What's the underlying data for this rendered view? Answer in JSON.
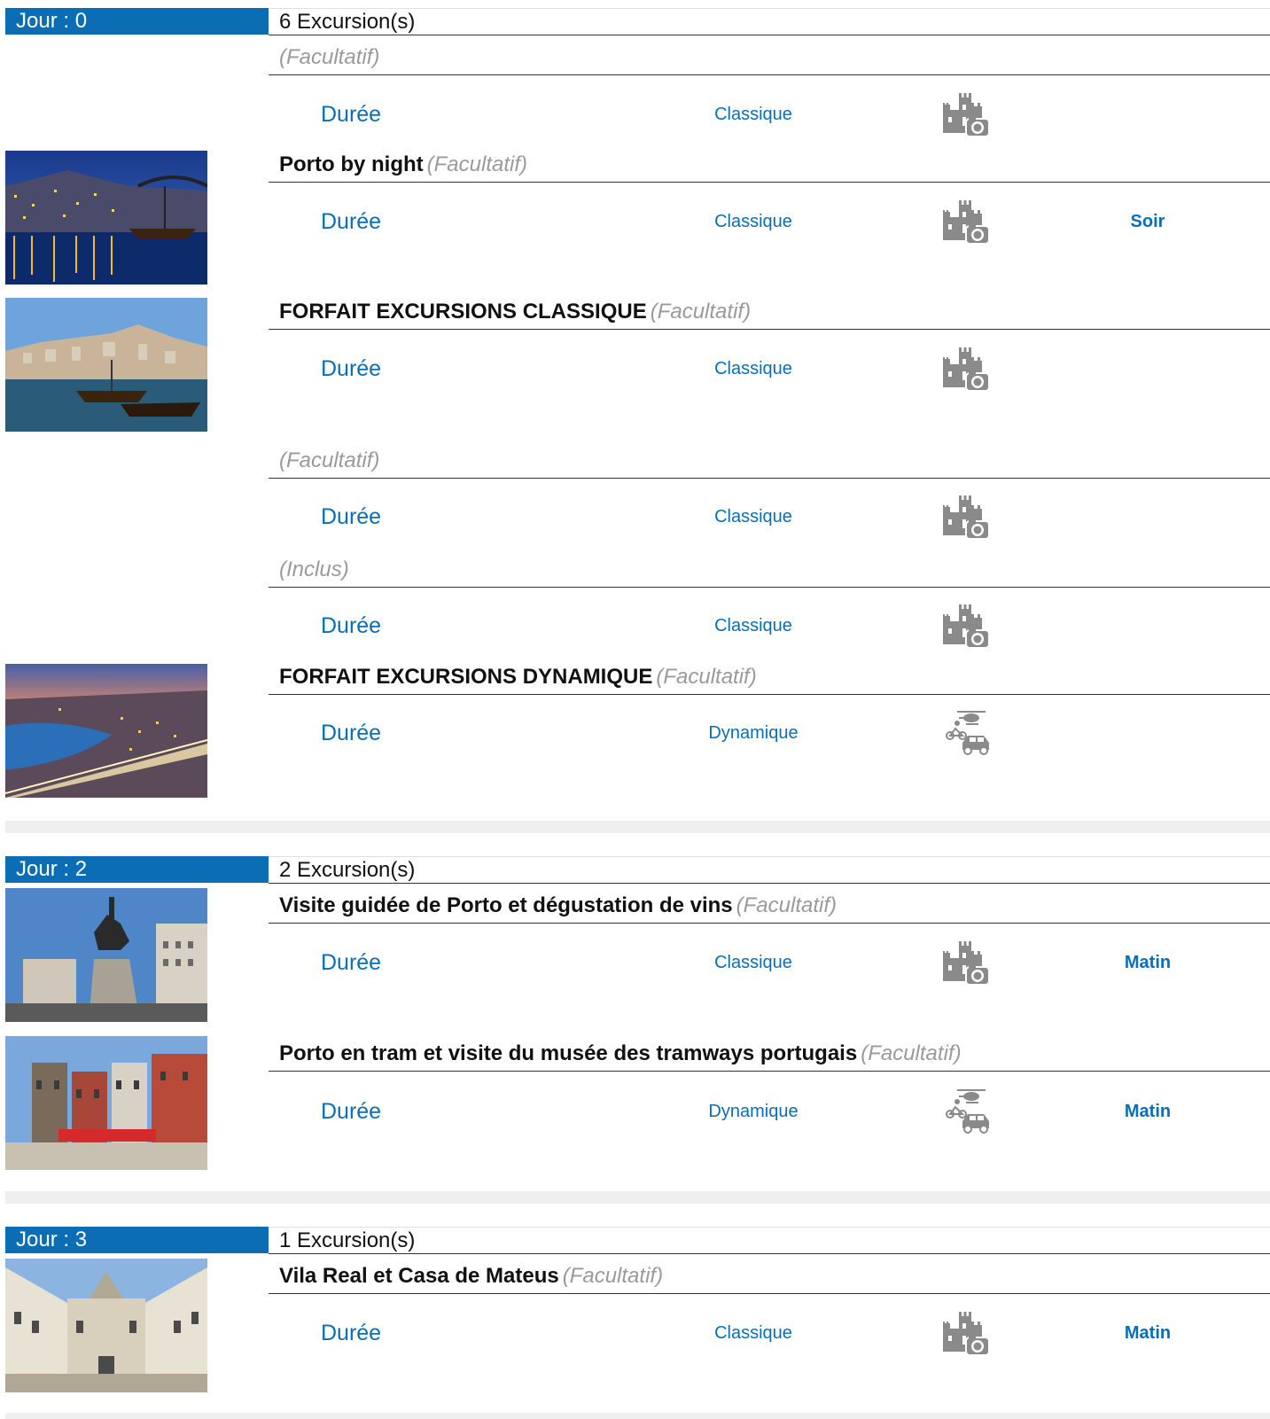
{
  "days": [
    {
      "label": "Jour : 0",
      "count": "6 Excursion(s)",
      "excursions": [
        {
          "title": "",
          "status": "(Facultatif)",
          "duree": "Durée",
          "type": "Classique",
          "type_icon": "castle-camera-icon",
          "moment": ""
        },
        {
          "title": "Porto by night",
          "status": "(Facultatif)",
          "duree": "Durée",
          "type": "Classique",
          "type_icon": "castle-camera-icon",
          "moment": "Soir",
          "photo": "porto-night-river-photo"
        },
        {
          "title": "FORFAIT EXCURSIONS CLASSIQUE",
          "status": "(Facultatif)",
          "duree": "Durée",
          "type": "Classique",
          "type_icon": "castle-camera-icon",
          "moment": "",
          "photo": "porto-boats-photo"
        },
        {
          "title": "",
          "status": "(Facultatif)",
          "duree": "Durée",
          "type": "Classique",
          "type_icon": "castle-camera-icon",
          "moment": ""
        },
        {
          "title": "",
          "status": "(Inclus)",
          "duree": "Durée",
          "type": "Classique",
          "type_icon": "castle-camera-icon",
          "moment": ""
        },
        {
          "title": "FORFAIT EXCURSIONS DYNAMIQUE",
          "status": "(Facultatif)",
          "duree": "Durée",
          "type": "Dynamique",
          "type_icon": "helicopter-bike-car-icon",
          "moment": "",
          "photo": "porto-bridge-dusk-photo"
        }
      ]
    },
    {
      "label": "Jour : 2",
      "count": "2 Excursion(s)",
      "excursions": [
        {
          "title": "Visite guidée de Porto et dégustation de vins",
          "status": "(Facultatif)",
          "duree": "Durée",
          "type": "Classique",
          "type_icon": "castle-camera-icon",
          "moment": "Matin",
          "photo": "equestrian-statue-photo"
        },
        {
          "title": "Porto en tram et visite du musée des tramways portugais",
          "status": "(Facultatif)",
          "duree": "Durée",
          "type": "Dynamique",
          "type_icon": "helicopter-bike-car-icon",
          "moment": "Matin",
          "photo": "ribeira-square-photo"
        }
      ]
    },
    {
      "label": "Jour : 3",
      "count": "1 Excursion(s)",
      "excursions": [
        {
          "title": "Vila Real et Casa de Mateus",
          "status": "(Facultatif)",
          "duree": "Durée",
          "type": "Classique",
          "type_icon": "castle-camera-icon",
          "moment": "Matin",
          "photo": "casa-mateus-photo"
        }
      ]
    }
  ],
  "colors": {
    "accent": "#0b6eb5",
    "muted": "#9a9a9a",
    "separator": "#efefef"
  }
}
